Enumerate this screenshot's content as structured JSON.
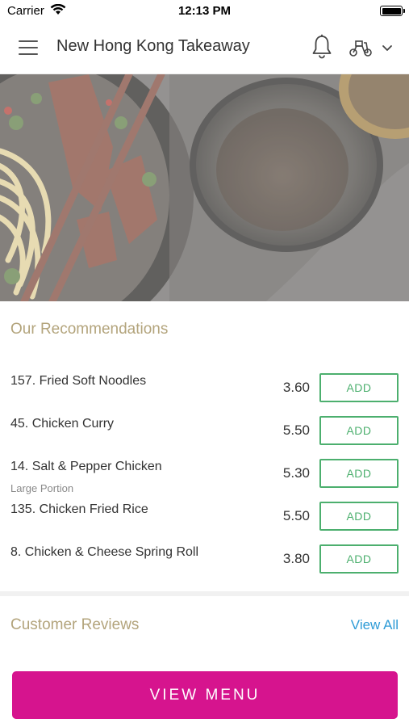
{
  "status_bar": {
    "carrier": "Carrier",
    "time": "12:13 PM"
  },
  "header": {
    "title": "New Hong Kong Takeaway",
    "icons": [
      "menu-icon",
      "bell-icon",
      "scooter-icon",
      "chevron-down-icon"
    ]
  },
  "recommendations": {
    "title": "Our Recommendations",
    "add_label": "ADD",
    "items": [
      {
        "name": "157. Fried Soft Noodles",
        "subtitle": "",
        "price": "3.60"
      },
      {
        "name": "45. Chicken Curry",
        "subtitle": "",
        "price": "5.50"
      },
      {
        "name": "14. Salt & Pepper Chicken",
        "subtitle": "Large Portion",
        "price": "5.30"
      },
      {
        "name": "135. Chicken Fried Rice",
        "subtitle": "",
        "price": "5.50"
      },
      {
        "name": "8. Chicken & Cheese Spring Roll",
        "subtitle": "",
        "price": "3.80"
      }
    ]
  },
  "reviews": {
    "title": "Customer Reviews",
    "view_all": "View All"
  },
  "cta": {
    "label": "VIEW MENU"
  },
  "colors": {
    "accent_gold": "#b3a47c",
    "add_green": "#4caf6e",
    "link_blue": "#2e9bd6",
    "cta_magenta": "#d6148e"
  }
}
